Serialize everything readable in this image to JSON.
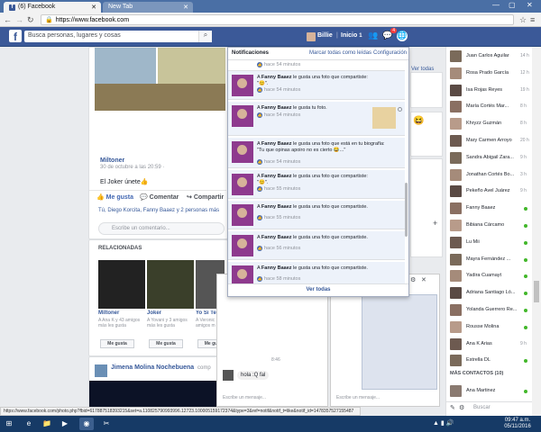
{
  "browser": {
    "tabs": [
      {
        "label": "(6) Facebook",
        "active": true
      },
      {
        "label": "New Tab",
        "active": false
      }
    ],
    "url": "https://www.facebook.com"
  },
  "fb_header": {
    "logo": "f",
    "search_placeholder": "Busca personas, lugares y cosas",
    "user_name": "Billie",
    "home_label": "Inicio",
    "home_count": "1",
    "friend_requests_badge": "",
    "messages_badge": "4",
    "notifications_badge": ""
  },
  "post": {
    "author": "Miltoner",
    "time": "30 de octubre a las 20:59 · ",
    "caption": "El Joker únete👍",
    "actions": {
      "like": "Me gusta",
      "comment": "Comentar",
      "share": "Compartir"
    },
    "likers": "Tú, Diego Korcita, Fanny Baaez y 2 personas más",
    "comment_placeholder": "Escribe un comentario..."
  },
  "related": {
    "title": "RELACIONADAS",
    "items": [
      {
        "name": "Miltoner",
        "sub": "A Ana K y 43 amigos más les gusta",
        "button": "Me gusta"
      },
      {
        "name": "Joker",
        "sub": "A Yovani y 3 amigos más les gusta",
        "button": "Me gusta"
      },
      {
        "name": "Yo Si Te Amo Verdad..",
        "sub": "A Veronic amigos m",
        "button": "Me gu"
      }
    ]
  },
  "next_post": {
    "author": "Jimena Molina Nochebuena",
    "sub": "comp"
  },
  "notifications": {
    "title": "Notificaciones",
    "mark_all_read": "Marcar todas como leídas",
    "settings": "Configuración",
    "see_all": "Ver todas",
    "items": [
      {
        "text": "",
        "time": "hace 54 minutos",
        "thumbnail": false
      },
      {
        "prefix": "A",
        "actor": "Fanny Baaez",
        "text": "le gusta una foto que compartiste: \"😊\".",
        "time": "hace 54 minutos",
        "thumbnail": false
      },
      {
        "prefix": "A",
        "actor": "Fanny Baaez",
        "text": "le gusta tu foto.",
        "time": "hace 54 minutos",
        "thumbnail": true
      },
      {
        "prefix": "A",
        "actor": "Fanny Baaez",
        "text": "le gusta una foto que está en tu biografía: \"Tu que opinas apoiro no es cierto 😂...\"",
        "time": "hace 54 minutos",
        "thumbnail": false
      },
      {
        "prefix": "A",
        "actor": "Fanny Baaez",
        "text": "le gusta una foto que compartiste: \"😊\".",
        "time": "hace 55 minutos",
        "thumbnail": false
      },
      {
        "prefix": "A",
        "actor": "Fanny Baaez",
        "text": "le gusta una foto que compartiste.",
        "time": "hace 55 minutos",
        "thumbnail": false
      },
      {
        "prefix": "A",
        "actor": "Fanny Baaez",
        "text": "le gusta una foto que compartiste.",
        "time": "hace 56 minutos",
        "thumbnail": false
      },
      {
        "prefix": "A",
        "actor": "Fanny Baaez",
        "text": "le gusta una foto que compartiste.",
        "time": "hace 58 minutos",
        "thumbnail": false
      }
    ]
  },
  "right_fragment": {
    "see_all": "Ver todas"
  },
  "chat": {
    "time_label": "8:46",
    "message": "hola :Q fal",
    "input_placeholder": "Escribe un mensaje..."
  },
  "contacts": {
    "list": [
      {
        "name": "Juan Carlos Aguilar",
        "status": "14 h"
      },
      {
        "name": "Rosa Prado García",
        "status": "12 h"
      },
      {
        "name": "Isa Rojas Reyes",
        "status": "19 h"
      },
      {
        "name": "María Cortés Mar...",
        "status": "8 h"
      },
      {
        "name": "Khryzz Guzmán",
        "status": "8 h"
      },
      {
        "name": "Mary Carmen Arroyo",
        "status": "20 h"
      },
      {
        "name": "Sandra Abigail Zara...",
        "status": "9 h"
      },
      {
        "name": "Jonathan Cortés Bo...",
        "status": "3 h"
      },
      {
        "name": "Pekeño Avel Juárez",
        "status": "9 h"
      },
      {
        "name": "Fanny Baaez",
        "status": ""
      },
      {
        "name": "Bibiana Cárcamo",
        "status": ""
      },
      {
        "name": "Lu Mii",
        "status": ""
      },
      {
        "name": "Mayra Fernández ...",
        "status": ""
      },
      {
        "name": "Yadira Cuamayt",
        "status": ""
      },
      {
        "name": "Adriana Santiago Ló...",
        "status": ""
      },
      {
        "name": "Yolanda Guerrero Re...",
        "status": ""
      },
      {
        "name": "Rousse Molina",
        "status": ""
      },
      {
        "name": "Ana K Arias",
        "status": "9 h"
      },
      {
        "name": "Estrella DL",
        "status": ""
      }
    ],
    "more_contacts_label": "MÁS CONTACTOS (10)",
    "more": [
      {
        "name": "Ana Martinez"
      }
    ],
    "search_placeholder": "Buscar"
  },
  "statusbar": {
    "text": "https://www.facebook.com/photo.php?fbid=617887518393215&set=a.110825790993996.12723.100005159172374&type=3&ref=notif&notif_t=like&notif_id=1478357527155487"
  },
  "taskbar": {
    "time": "09:47 a.m.",
    "date": "05/11/2016"
  },
  "colors": {
    "fb_blue": "#3b5998",
    "link_blue": "#365899",
    "online_green": "#42b72a",
    "badge_red": "#fa3e3e"
  }
}
